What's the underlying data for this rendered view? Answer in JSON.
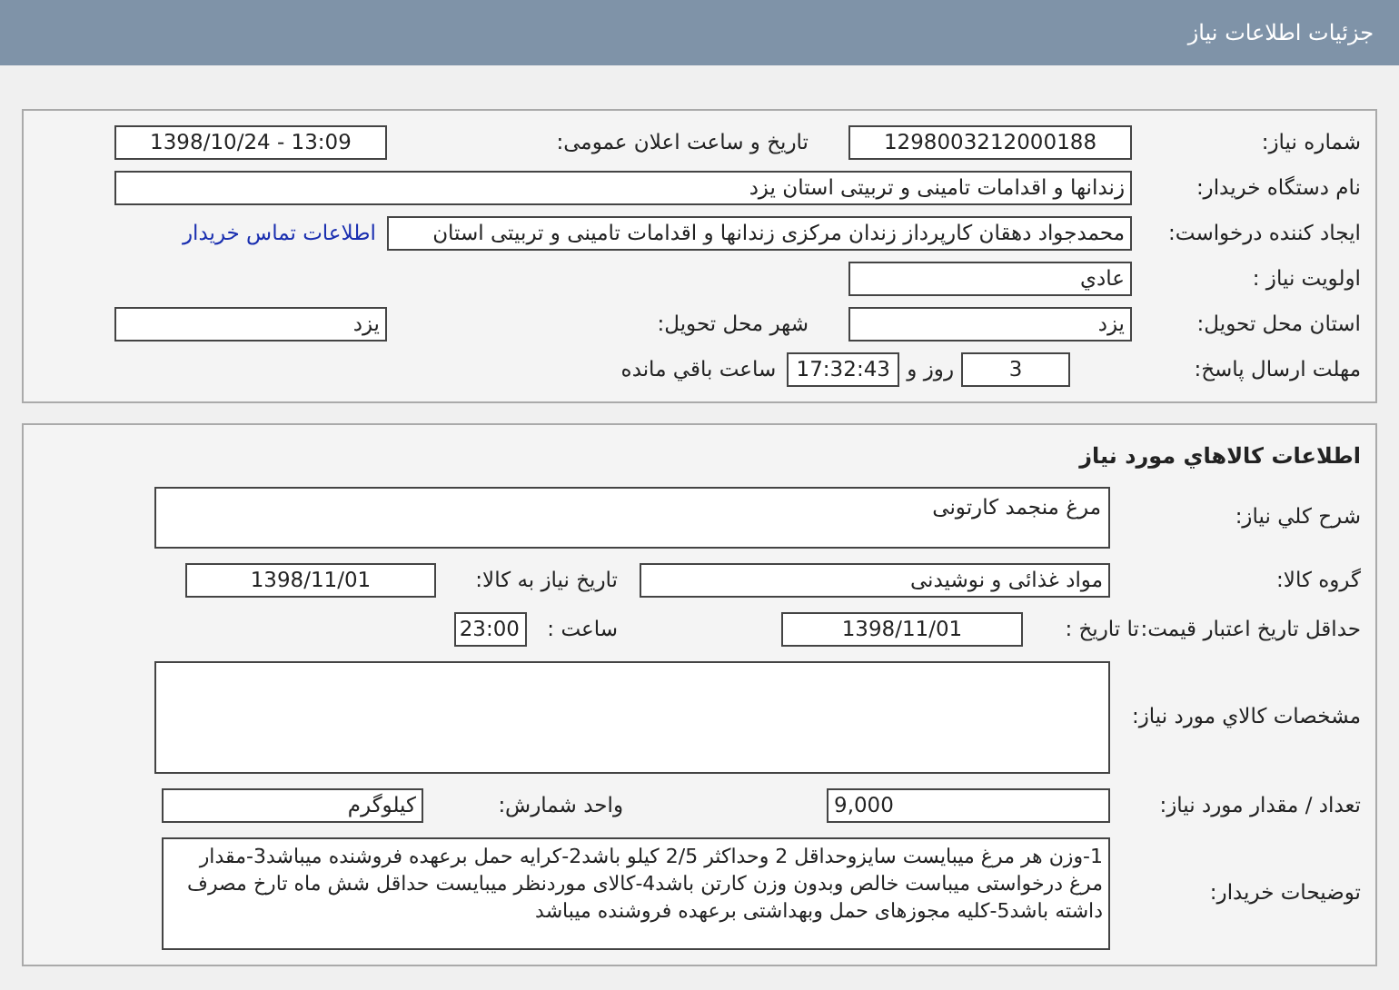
{
  "header": {
    "title": "جزئیات اطلاعات نیاز"
  },
  "need_info": {
    "need_number": {
      "label": "شماره نیاز:",
      "value": "1298003212000188"
    },
    "announce_datetime": {
      "label": "تاریخ و ساعت اعلان عمومی:",
      "value": "1398/10/24 - 13:09"
    },
    "buyer_org": {
      "label": "نام دستگاه خریدار:",
      "value": "زندانها و اقدامات تامینی و تربیتی استان یزد"
    },
    "requester": {
      "label": "ایجاد کننده درخواست:",
      "value": "محمدجواد دهقان کارپرداز زندان مرکزی زندانها و اقدامات تامینی و تربیتی استان"
    },
    "contact_link": "اطلاعات تماس خریدار",
    "priority": {
      "label": "اولویت نیاز :",
      "value": "عادي"
    },
    "province": {
      "label": "استان محل تحویل:",
      "value": "یزد"
    },
    "city": {
      "label": "شهر محل تحویل:",
      "value": "یزد"
    },
    "deadline": {
      "label": "مهلت ارسال پاسخ:",
      "days": "3",
      "days_label": "روز و",
      "time": "17:32:43",
      "time_label": "ساعت باقي مانده"
    }
  },
  "goods": {
    "title": "اطلاعات کالاهاي مورد نياز",
    "summary": {
      "label": "شرح کلي نياز:",
      "value": "مرغ منجمد کارتونی"
    },
    "group": {
      "label": "گروه کالا:",
      "value": "مواد غذائی و نوشیدنی"
    },
    "need_date": {
      "label": "تاریخ نیاز به کالا:",
      "value": "1398/11/01"
    },
    "price_validity": {
      "label": "حداقل تاریخ اعتبار قیمت:",
      "to_date_label": "تا تاریخ :",
      "date": "1398/11/01",
      "time_label": "ساعت :",
      "time": "23:00"
    },
    "specs": {
      "label": "مشخصات کالاي مورد نياز:"
    },
    "quantity": {
      "label": "تعداد / مقدار مورد نیاز:",
      "value": "9,000"
    },
    "unit": {
      "label": "واحد شمارش:",
      "value": "کیلوگرم"
    },
    "buyer_notes": {
      "label": "توضیحات خریدار:",
      "value": "1-وزن هر مرغ میبایست سایزوحداقل 2 وحداکثر 2/5 کیلو باشد2-کرایه حمل برعهده فروشنده میباشد3-مقدار مرغ درخواستی میباست خالص وبدون وزن کارتن باشد4-کالای موردنظر میبایست حداقل شش ماه تارخ مصرف داشته باشد5-کلیه مجوزهای حمل وبهداشتی برعهده فروشنده میباشد"
    }
  }
}
